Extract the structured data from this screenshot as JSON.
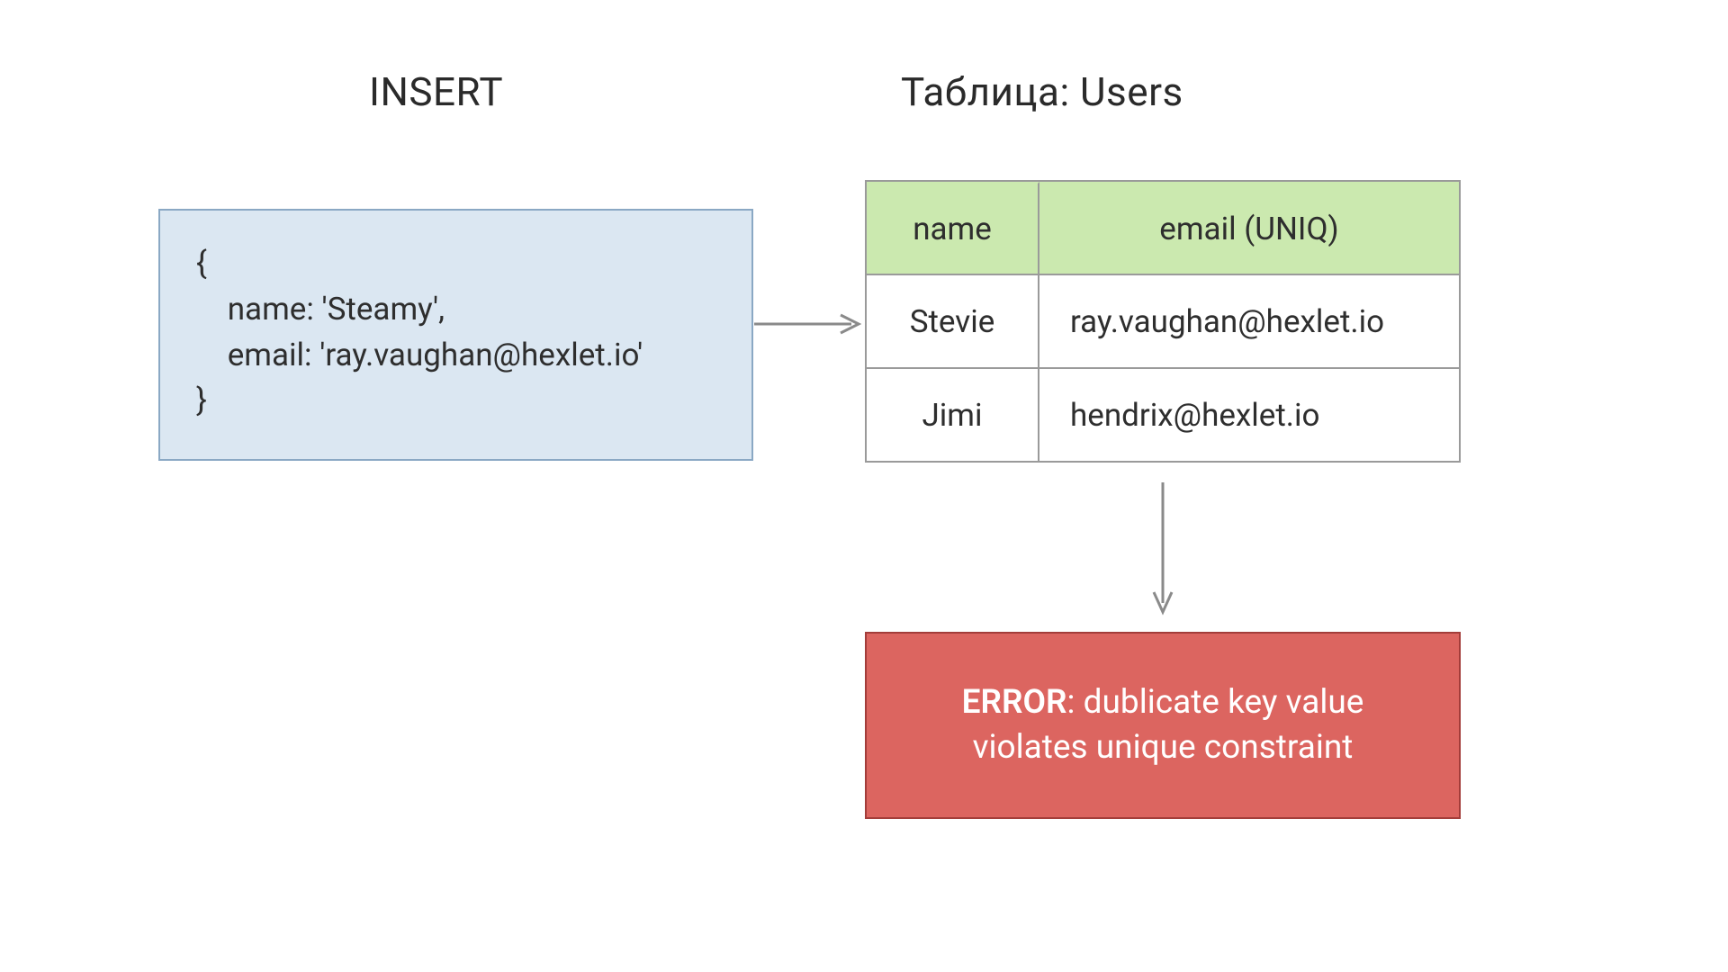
{
  "headings": {
    "insert": "INSERT",
    "table": "Таблица: Users"
  },
  "insert_payload": {
    "open": "{",
    "name_key": "name",
    "name_value": "'Steamy'",
    "email_key": "email",
    "email_value": "'ray.vaughan@hexlet.io'",
    "close": "}"
  },
  "table": {
    "columns": {
      "name": "name",
      "email": "email (UNIQ)"
    },
    "rows": [
      {
        "name": "Stevie",
        "email": "ray.vaughan@hexlet.io"
      },
      {
        "name": "Jimi",
        "email": "hendrix@hexlet.io"
      }
    ]
  },
  "error": {
    "label": "ERROR",
    "message": "dublicate key value violates unique constraint"
  },
  "colors": {
    "insert_bg": "#dbe7f2",
    "insert_border": "#8aa8c4",
    "table_header_bg": "#cbe9af",
    "table_border": "#9a9a9a",
    "error_bg": "#dc6560",
    "error_border": "#a33d3a",
    "arrow": "#8a8a8a"
  }
}
